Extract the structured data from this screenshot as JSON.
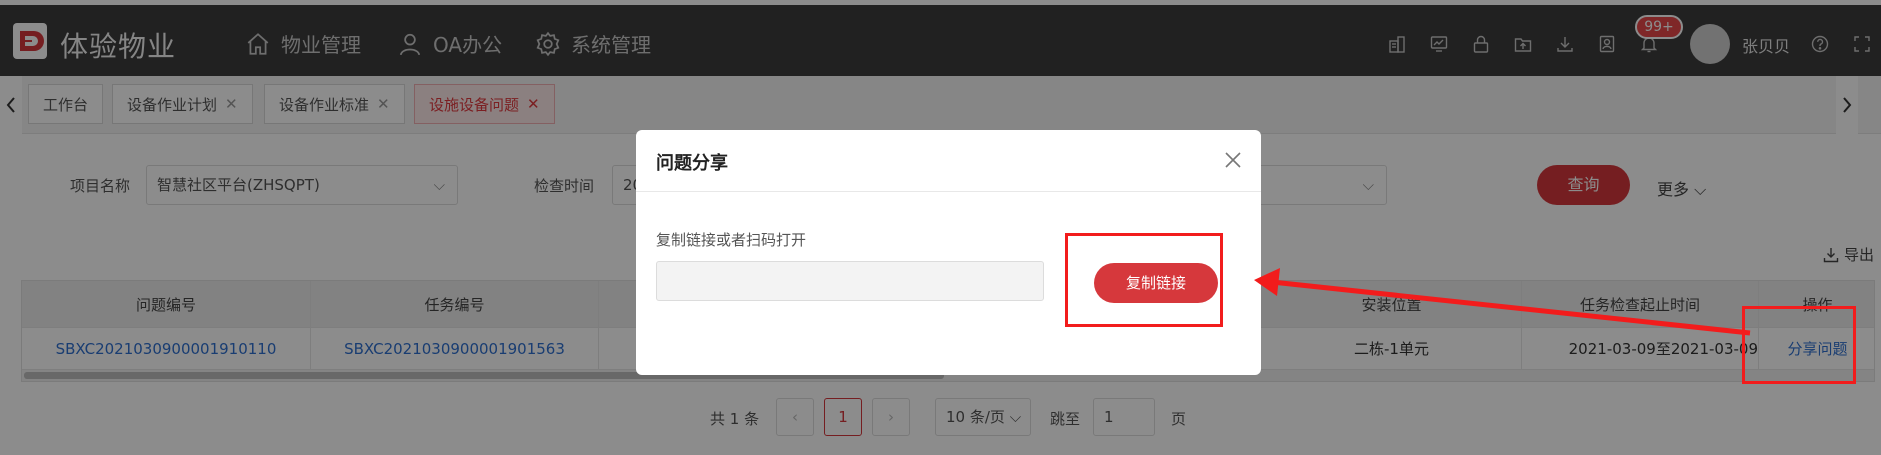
{
  "header": {
    "app_title": "体验物业",
    "nav": [
      {
        "label": "物业管理",
        "icon": "home-icon"
      },
      {
        "label": "OA办公",
        "icon": "user-icon"
      },
      {
        "label": "系统管理",
        "icon": "gear-icon"
      }
    ],
    "notification_badge": "99+",
    "username": "张贝贝"
  },
  "tabs": [
    {
      "label": "工作台",
      "closable": false
    },
    {
      "label": "设备作业计划",
      "closable": true
    },
    {
      "label": "设备作业标准",
      "closable": true
    },
    {
      "label": "设施设备问题",
      "closable": true,
      "active": true
    }
  ],
  "filters": {
    "project_label": "项目名称",
    "project_value": "智慧社区平台(ZHSQPT)",
    "time_label": "检查时间",
    "time_value_visible": "20",
    "query_button": "查询",
    "more_button": "更多"
  },
  "toolbar": {
    "export_label": "导出"
  },
  "table": {
    "headers": {
      "problem_no": "问题编号",
      "task_no": "任务编号",
      "location": "安装位置",
      "check_period": "任务检查起止时间",
      "action": "操作"
    },
    "rows": [
      {
        "problem_no": "SBXC2021030900001910110",
        "task_no": "SBXC2021030900001901563",
        "location": "二栋-1单元",
        "check_period": "2021-03-09至2021-03-09",
        "action": "分享问题"
      }
    ]
  },
  "pagination": {
    "total_text": "共 1 条",
    "current_page": "1",
    "page_size": "10 条/页",
    "jump_label": "跳至",
    "jump_value": "1",
    "page_suffix": "页"
  },
  "modal": {
    "title": "问题分享",
    "hint": "复制链接或者扫码打开",
    "link_value": "",
    "copy_button": "复制链接"
  },
  "colors": {
    "topbar": "#3d3d3d",
    "accent": "#d6383c",
    "annotation": "#f21c1c",
    "link": "#2f6fcf"
  }
}
